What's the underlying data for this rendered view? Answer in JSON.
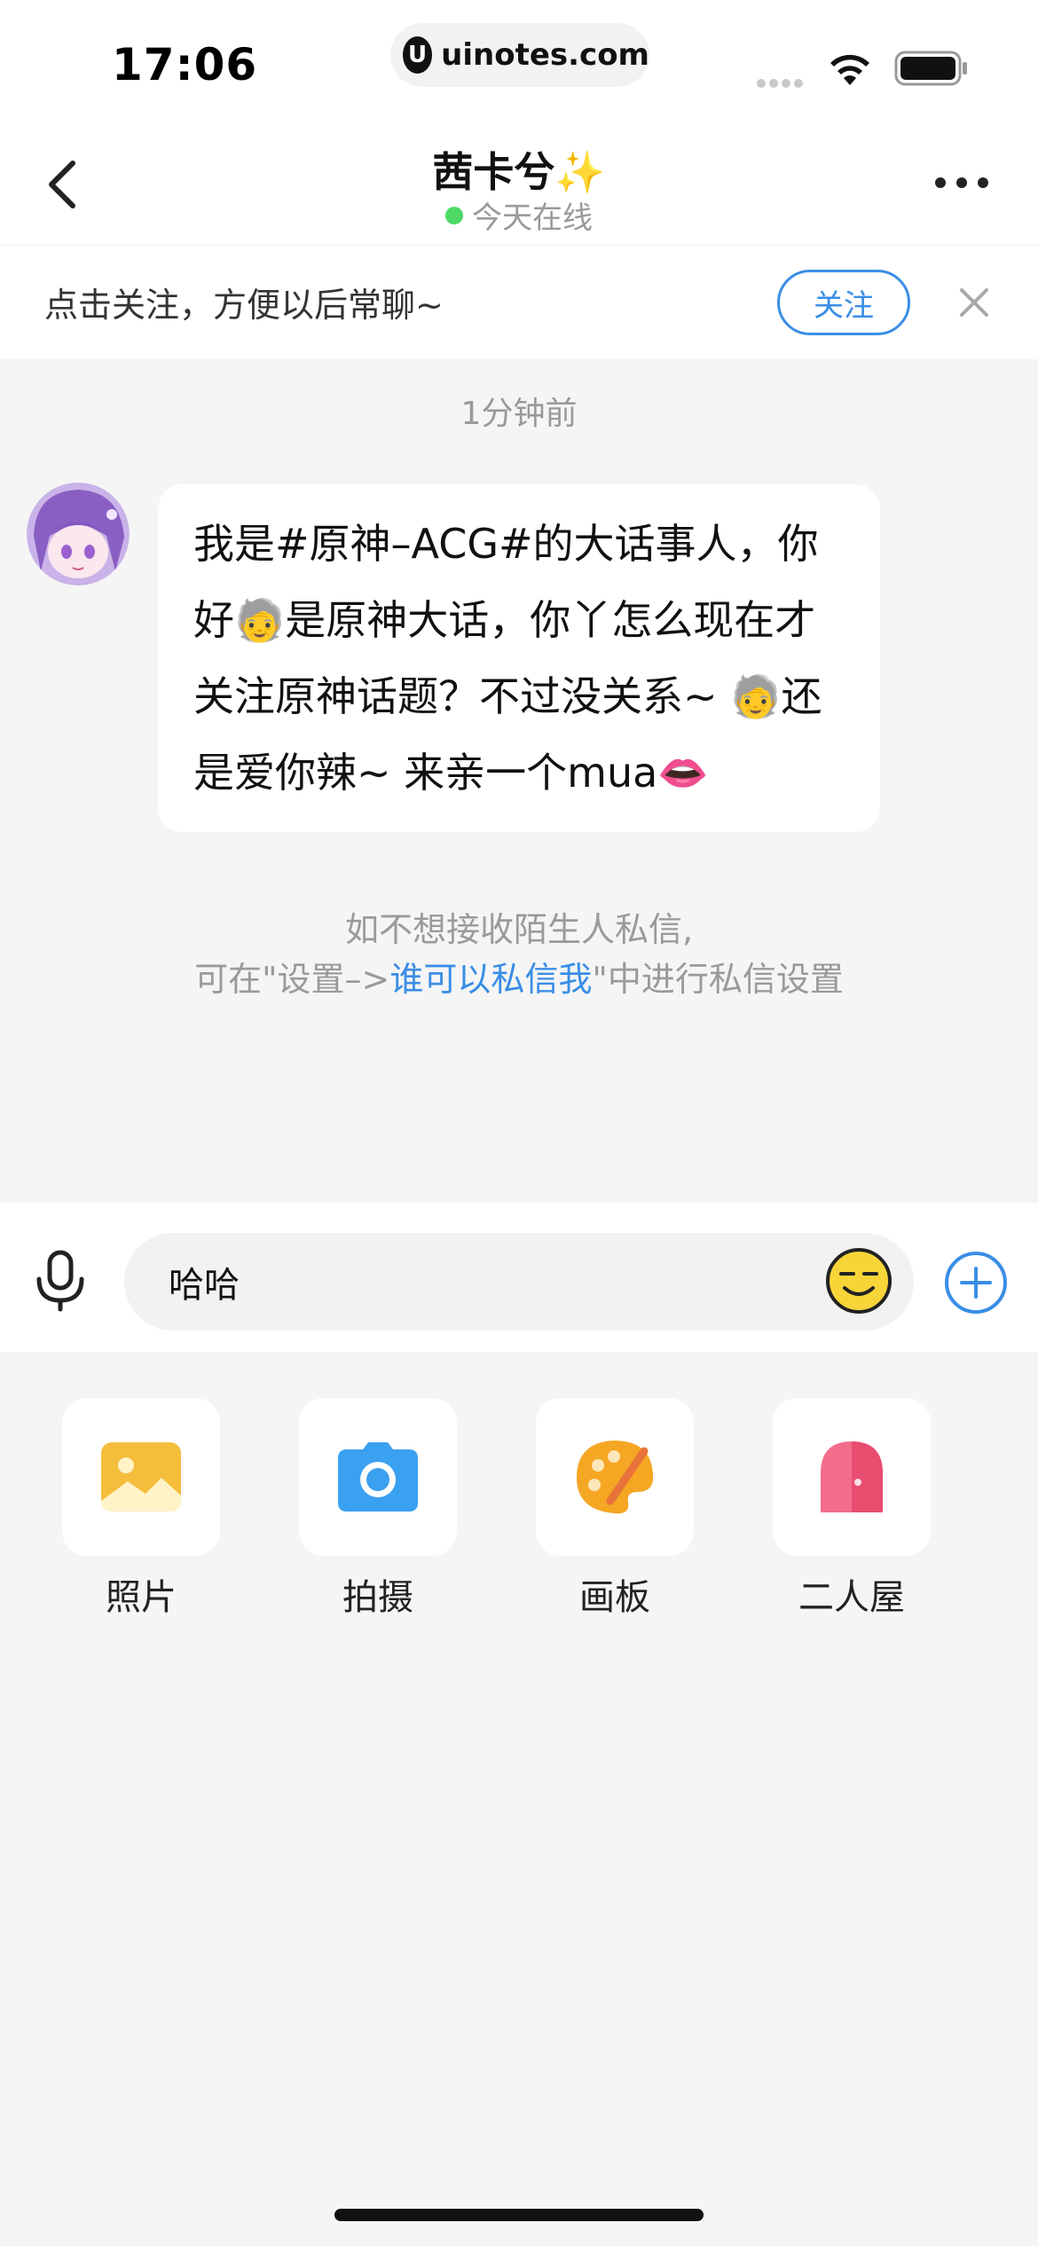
{
  "status_bar": {
    "time": "17:06",
    "url": "uinotes.com",
    "url_logo": "U"
  },
  "nav": {
    "title": "茜卡兮✨",
    "status": "今天在线",
    "back_icon": "chevron-left-icon",
    "more_icon": "ellipsis-icon"
  },
  "follow_banner": {
    "tip": "点击关注，方便以后常聊~",
    "button_label": "关注"
  },
  "chat": {
    "timestamp": "1分钟前",
    "message": "我是#原神–ACG#的大话事人，你好🧓是原神大话，你丫怎么现在才关注原神话题？不过没关系~ 🧓还是爱你辣~  来亲一个mua👄"
  },
  "notice": {
    "line1": "如不想接收陌生人私信,",
    "line2_prefix": "可在\"设置–>",
    "line2_link": "谁可以私信我",
    "line2_suffix": "\"中进行私信设置"
  },
  "input": {
    "value": "哈哈",
    "mic_icon": "microphone-icon",
    "emoji_icon": "smirk-emoji-icon",
    "plus_icon": "plus-circle-icon"
  },
  "tools": [
    {
      "label": "照片",
      "icon": "photo-icon"
    },
    {
      "label": "拍摄",
      "icon": "camera-icon"
    },
    {
      "label": "画板",
      "icon": "palette-icon"
    },
    {
      "label": "二人屋",
      "icon": "door-icon"
    }
  ],
  "colors": {
    "accent": "#3a8ee6",
    "online": "#4cd964",
    "background": "#f5f5f5"
  }
}
